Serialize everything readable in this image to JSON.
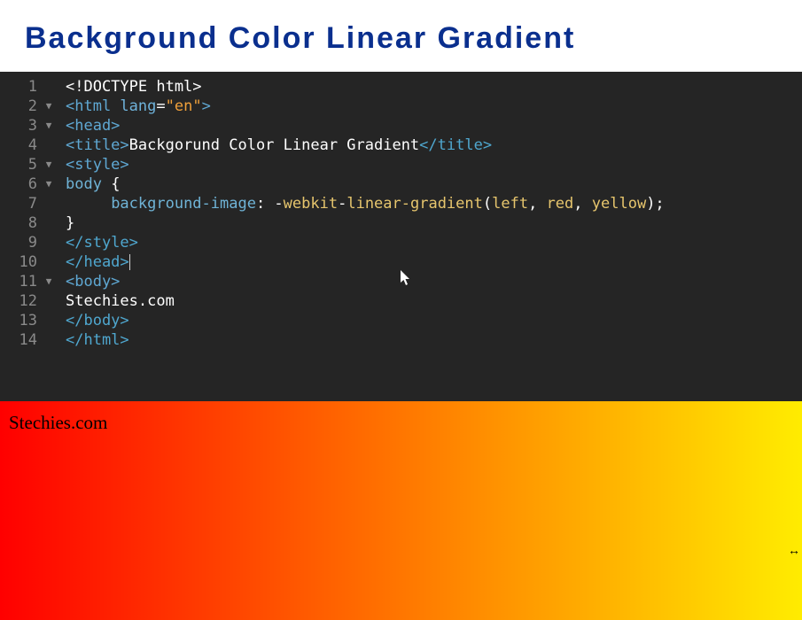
{
  "header": {
    "title": "Background Color Linear Gradient"
  },
  "editor": {
    "lines": [
      {
        "n": "1",
        "fold": "",
        "html": "<span class='tok-white'>&lt;!DOCTYPE html&gt;</span>"
      },
      {
        "n": "2",
        "fold": "▼",
        "html": "<span class='tok-tag'>&lt;html </span><span class='tok-attr'>lang</span><span class='tok-white'>=</span><span class='tok-str'>\"en\"</span><span class='tok-tag'>&gt;</span>"
      },
      {
        "n": "3",
        "fold": "▼",
        "html": "<span class='tok-tag'>&lt;head&gt;</span>"
      },
      {
        "n": "4",
        "fold": "",
        "html": "<span class='tok-tag'>&lt;title&gt;</span><span class='tok-white'>Backgorund Color Linear Gradient</span><span class='tok-close'>&lt;/title&gt;</span>"
      },
      {
        "n": "5",
        "fold": "▼",
        "html": "<span class='tok-tag'>&lt;style&gt;</span>"
      },
      {
        "n": "6",
        "fold": "▼",
        "html": "<span class='tok-ident'>body</span><span class='tok-white'> {</span>"
      },
      {
        "n": "7",
        "fold": "",
        "html": "<span class='tok-white'>     </span><span class='tok-prop'>background-image</span><span class='tok-white'>: -</span><span class='tok-func'>webkit</span><span class='tok-white'>-</span><span class='tok-func'>linear-gradient</span><span class='tok-white'>(</span><span class='tok-val'>left</span><span class='tok-white'>, </span><span class='tok-val'>red</span><span class='tok-white'>, </span><span class='tok-val'>yellow</span><span class='tok-white'>);</span>"
      },
      {
        "n": "8",
        "fold": "",
        "html": "<span class='tok-white'>}</span>"
      },
      {
        "n": "9",
        "fold": "",
        "html": "<span class='tok-close'>&lt;/style&gt;</span>"
      },
      {
        "n": "10",
        "fold": "",
        "html": "<span class='tok-close'>&lt;/head&gt;</span><span class='cursor'></span>"
      },
      {
        "n": "11",
        "fold": "▼",
        "html": "<span class='tok-tag'>&lt;body&gt;</span>"
      },
      {
        "n": "12",
        "fold": "",
        "html": "<span class='tok-white'>Stechies.com</span>"
      },
      {
        "n": "13",
        "fold": "",
        "html": "<span class='tok-close'>&lt;/body&gt;</span>"
      },
      {
        "n": "14",
        "fold": "",
        "html": "<span class='tok-close'>&lt;/html&gt;</span>"
      }
    ]
  },
  "preview": {
    "body_text": "Stechies.com",
    "gradient_from": "#ff0000",
    "gradient_to": "#ffec00"
  }
}
